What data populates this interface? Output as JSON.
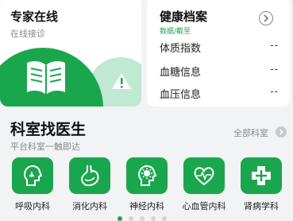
{
  "expert": {
    "title": "专家在线",
    "subtitle": "在线接诊"
  },
  "health": {
    "title": "健康档案",
    "tag": "数据/截至",
    "rows": [
      {
        "label": "体质指数",
        "value": "--"
      },
      {
        "label": "血糖信息",
        "value": "--"
      },
      {
        "label": "血压信息",
        "value": "--"
      }
    ]
  },
  "section": {
    "title": "科室找医生",
    "subtitle": "平台科室一触即达",
    "all_link": "全部科室"
  },
  "departments": [
    {
      "label": "呼吸内科",
      "icon": "respiratory-icon"
    },
    {
      "label": "消化内科",
      "icon": "stomach-icon"
    },
    {
      "label": "神经内科",
      "icon": "brain-icon"
    },
    {
      "label": "心血管内科",
      "icon": "heart-icon"
    },
    {
      "label": "肾病学科",
      "icon": "medical-cross-icon"
    }
  ],
  "pager": {
    "count": 5,
    "active": 0
  },
  "colors": {
    "accent": "#1aa64d",
    "accent_light": "#bfe9d2",
    "background": "#f2f3f5"
  }
}
